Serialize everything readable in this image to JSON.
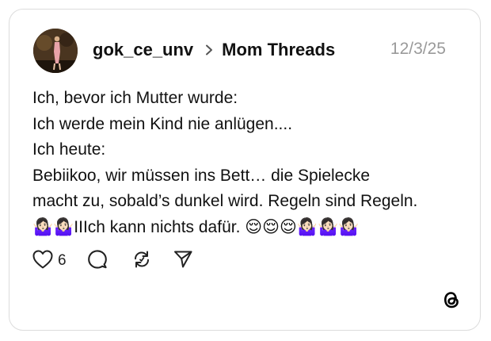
{
  "post": {
    "username": "gok_ce_unv",
    "community": "Mom Threads",
    "date": "12/3/25",
    "lines": [
      "Ich, bevor ich Mutter wurde:",
      "Ich werde mein Kind nie anlügen....",
      "Ich heute:",
      "Bebiikoo, wir müssen ins Bett… die Spielecke",
      "macht zu, sobald’s dunkel wird. Regeln sind Regeln.",
      "🤷🏻‍♀️🤷🏻‍♀️IIIch kann nichts dafür. 😌😌😌🤷🏻‍♀️🤷🏻‍♀️🤷🏻‍♀️"
    ]
  },
  "actions": {
    "like_count": "6",
    "icons": [
      "heart-icon",
      "comment-icon",
      "repost-icon",
      "share-icon"
    ]
  },
  "branding": {
    "logo_icon": "threads-logo-icon"
  },
  "colors": {
    "text": "#111111",
    "date": "#9a9a9a",
    "border": "#dcdcdc"
  }
}
